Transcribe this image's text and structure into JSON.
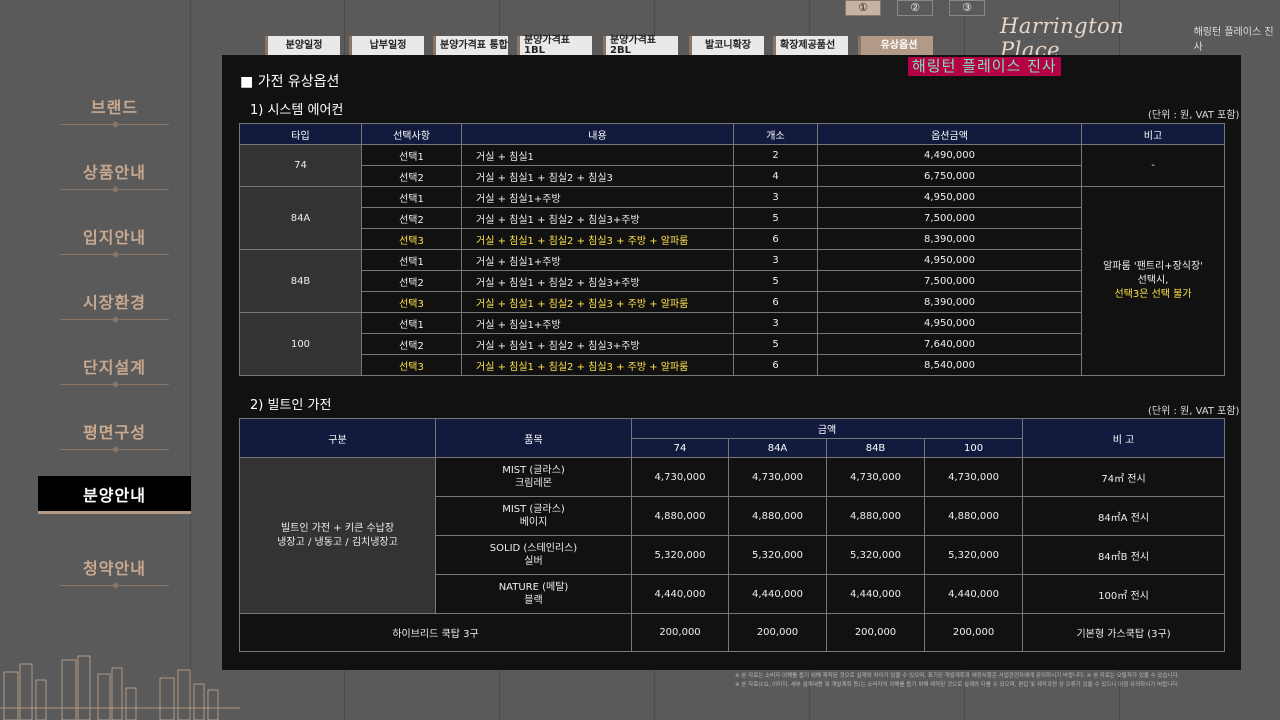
{
  "page_buttons": [
    "①",
    "②",
    "③"
  ],
  "logo": {
    "script": "Harrington Place",
    "kr": "해링턴 플레이스 진사"
  },
  "tabs": [
    "분양일정",
    "납부일정",
    "분양가격표 통합",
    "분양가격표 1BL",
    "분양가격표 2BL",
    "발코니확장",
    "확장제공품선",
    "유상옵션"
  ],
  "badge": "해링턴 플레이스 진사",
  "sidebar": [
    "브랜드",
    "상품안내",
    "입지안내",
    "시장환경",
    "단지설계",
    "평면구성",
    "분양안내",
    "청약안내"
  ],
  "main_title": "가전 유상옵션",
  "aircon": {
    "title": "1) 시스템 에어컨",
    "unit": "(단위 : 원, VAT 포함)",
    "headers": [
      "타입",
      "선택사항",
      "내용",
      "개소",
      "옵션금액",
      "비고"
    ],
    "groups": [
      {
        "type": "74",
        "rows": [
          {
            "opt": "선택1",
            "content": "거실 + 침실1",
            "count": "2",
            "price": "4,490,000"
          },
          {
            "opt": "선택2",
            "content": "거실 + 침실1 + 침실2 + 침실3",
            "count": "4",
            "price": "6,750,000"
          }
        ]
      },
      {
        "type": "84A",
        "rows": [
          {
            "opt": "선택1",
            "content": "거실 + 침실1+주방",
            "count": "3",
            "price": "4,950,000"
          },
          {
            "opt": "선택2",
            "content": "거실 + 침실1 + 침실2 + 침실3+주방",
            "count": "5",
            "price": "7,500,000"
          },
          {
            "opt": "선택3",
            "content": "거실 + 침실1 + 침실2 + 침실3 + 주방 + 알파룸",
            "count": "6",
            "price": "8,390,000"
          }
        ]
      },
      {
        "type": "84B",
        "rows": [
          {
            "opt": "선택1",
            "content": "거실 + 침실1+주방",
            "count": "3",
            "price": "4,950,000"
          },
          {
            "opt": "선택2",
            "content": "거실 + 침실1 + 침실2 + 침실3+주방",
            "count": "5",
            "price": "7,500,000"
          },
          {
            "opt": "선택3",
            "content": "거실 + 침실1 + 침실2 + 침실3 + 주방 + 알파룸",
            "count": "6",
            "price": "8,390,000"
          }
        ]
      },
      {
        "type": "100",
        "rows": [
          {
            "opt": "선택1",
            "content": "거실 + 침실1+주방",
            "count": "3",
            "price": "4,950,000"
          },
          {
            "opt": "선택2",
            "content": "거실 + 침실1 + 침실2 + 침실3+주방",
            "count": "5",
            "price": "7,640,000"
          },
          {
            "opt": "선택3",
            "content": "거실 + 침실1 + 침실2 + 침실3 + 주방 + 알파룸",
            "count": "6",
            "price": "8,540,000"
          }
        ]
      }
    ],
    "note_74": "-",
    "note_rest_line1": "알파룸 '팬트리+장식장'",
    "note_rest_line2": "선택시,",
    "note_rest_line3": "선택3은 선택 불가"
  },
  "builtin": {
    "title": "2) 빌트인 가전",
    "unit": "(단위 : 원, VAT 포함)",
    "h_category": "구분",
    "h_item": "품목",
    "h_price": "금액",
    "h_note": "비 고",
    "types": [
      "74",
      "84A",
      "84B",
      "100"
    ],
    "category_line1": "빌트인 가전 + 키큰 수납장",
    "category_line2": "냉장고 / 냉동고 / 김치냉장고",
    "rows": [
      {
        "item1": "MIST (글라스)",
        "item2": "크림레몬",
        "prices": [
          "4,730,000",
          "4,730,000",
          "4,730,000",
          "4,730,000"
        ],
        "note": "74㎡ 전시"
      },
      {
        "item1": "MIST (글라스)",
        "item2": "베이지",
        "prices": [
          "4,880,000",
          "4,880,000",
          "4,880,000",
          "4,880,000"
        ],
        "note": "84㎡A 전시"
      },
      {
        "item1": "SOLID (스테인리스)",
        "item2": "실버",
        "prices": [
          "5,320,000",
          "5,320,000",
          "5,320,000",
          "5,320,000"
        ],
        "note": "84㎡B 전시"
      },
      {
        "item1": "NATURE (메탈)",
        "item2": "블랙",
        "prices": [
          "4,440,000",
          "4,440,000",
          "4,440,000",
          "4,440,000"
        ],
        "note": "100㎡ 전시"
      }
    ],
    "hybrid": {
      "label": "하이브리드 쿡탑 3구",
      "prices": [
        "200,000",
        "200,000",
        "200,000",
        "200,000"
      ],
      "note": "기본형 가스쿡탑 (3구)"
    }
  },
  "disclaimer_line1": "※ 본 자료는 소비자 이해를 돕기 위해 제작된 것으로 실제와 차이가 있을 수 있으며, 표기된 개발계획과 예정사항은 사업관련자에게 문의하시기 바랍니다.   ※ 본 자료는 오탈자가 있을 수 있습니다.",
  "disclaimer_line2": "※ 본 자료(CG, 이미지, 세부 설계내용 및 개발계획 등)는 소비자의 이해를 돕기 위해 제작된 것으로 실제와 다를 수 있으며, 편집 및 제작과정 상 오류가 있을 수 있으니 이점 유의하시기 바랍니다."
}
